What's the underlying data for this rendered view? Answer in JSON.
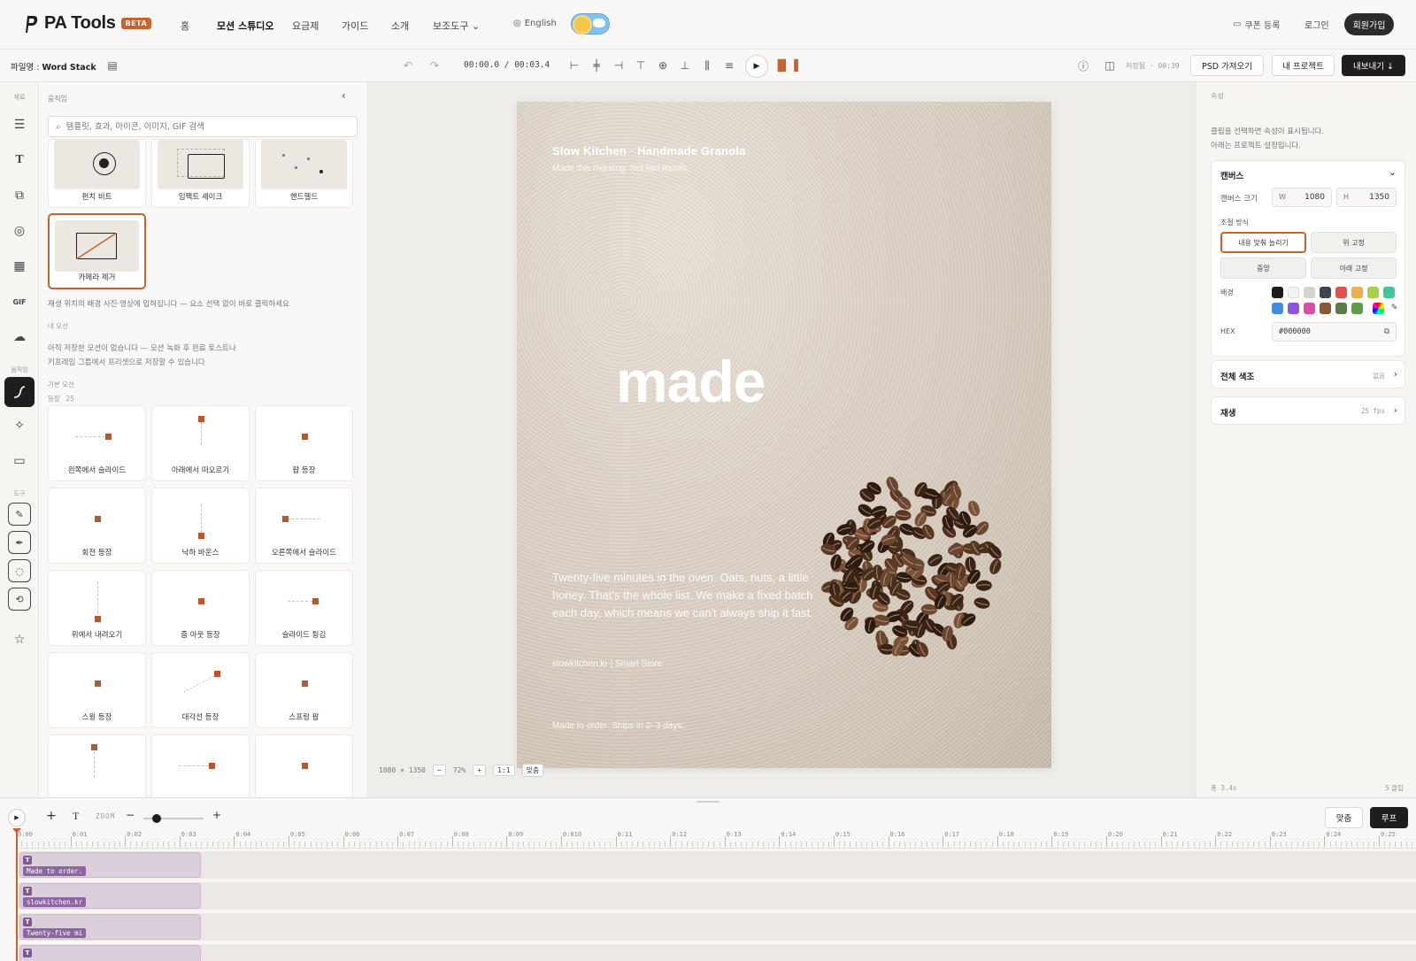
{
  "nav": {
    "brand": "PA Tools",
    "beta": "BETA",
    "links": [
      "홈",
      "모션 스튜디오",
      "요금제",
      "가이드",
      "소개",
      "보조도구"
    ],
    "active_link": "모션 스튜디오",
    "language": "English",
    "coupon": "쿠폰 등록",
    "login": "로그인",
    "signup": "회원가입"
  },
  "toolbar": {
    "filename_label": "파일명 : ",
    "filename": "Word Stack",
    "time": "00:00.0 / 00:03.4",
    "save_status": "저장됨 · 00:39",
    "psd_import": "PSD 가져오기",
    "my_projects": "내 프로젝트",
    "export": "내보내기 ↓"
  },
  "rail": {
    "section_materials": "재료",
    "section_motion": "움직임",
    "section_tools": "도구",
    "gif": "GIF"
  },
  "left_panel": {
    "title": "움직임",
    "search_placeholder": "템플릿, 효과, 아이콘, 이미지, GIF 검색",
    "top_cards": [
      "펀치 비트",
      "임팩트 셰이크",
      "핸드헬드"
    ],
    "selected_card": "카메라 제거",
    "hint": "재생 위치의 배경 사진·영상에 입혀집니다 — 요소 선택 없이 바로 클릭하세요",
    "my_motion_heading": "내 모션",
    "my_motion_empty_1": "아직 저장한 모션이 없습니다 — 모션 녹화 후 완료 토스트나",
    "my_motion_empty_2": "키프레임 그룹에서 프리셋으로 저장할 수 있습니다",
    "basic_heading": "기본 모션",
    "entrance_heading": "등장",
    "entrance_count": "25",
    "motion_cards": [
      "왼쪽에서 슬라이드",
      "아래에서 떠오르기",
      "팝 등장",
      "회전 등장",
      "낙하 바운스",
      "오른쪽에서 슬라이드",
      "위에서 내려오기",
      "줌 아웃 등장",
      "슬라이드 튕김",
      "스윙 등장",
      "대각선 등장",
      "스프링 팝",
      "",
      "",
      ""
    ]
  },
  "artboard": {
    "title": "Slow Kitchen · Handmade Granola",
    "subtitle": "Made this morning. Not last month.",
    "big_word": "made",
    "body": "Twenty-five minutes in the oven. Oats, nuts, a little honey. That's the whole list. We make a fixed batch each day, which means we can't always ship it fast.",
    "link": "slowkitchen.kr  |  Smart Store",
    "footer": "Made to order. Ships in 2–3 days."
  },
  "canvas_info": {
    "size": "1080 × 1350",
    "minus": "−",
    "zoom": "72%",
    "plus": "+",
    "ratio": "1:1",
    "fit": "맞춤"
  },
  "right_panel": {
    "title": "속성",
    "hint_1": "클립을 선택하면 속성이 표시됩니다.",
    "hint_2": "아래는 프로젝트 설정입니다.",
    "canvas_title": "캔버스",
    "canvas_size_label": "캔버스 크기",
    "w_key": "W",
    "w_value": "1080",
    "h_key": "H",
    "h_value": "1350",
    "fit_mode_label": "조절 방식",
    "fit_modes": [
      "내용 맞춰 늘리기",
      "위 고정",
      "중앙",
      "아래 고정"
    ],
    "bg_label": "배경",
    "swatches": [
      "#1b1b1b",
      "#f3f3f3",
      "#d6d3cc",
      "#3f4450",
      "#e0524e",
      "#e8b04a",
      "#a8cf4e",
      "#44c49a",
      "#3f8ee0",
      "#8a55e0",
      "#d94fa8",
      "#8a5733",
      "#5b7a4a",
      "#5e9e4a"
    ],
    "hex_label": "HEX",
    "hex_value": "#000000",
    "grading_title": "전체 색조",
    "grading_value": "없음",
    "playback_title": "재생",
    "playback_value": "25 fps",
    "total": "총 3.4s",
    "clips": "5 클립"
  },
  "timeline": {
    "zoom_label": "ZOOM",
    "fit": "맞춤",
    "loop": "루프",
    "ticks": [
      "0:00",
      "0:01",
      "0:02",
      "0:03",
      "0:04",
      "0:05",
      "0:06",
      "0:07",
      "0:08",
      "0:09",
      "0:010",
      "0:11",
      "0:12",
      "0:13",
      "0:14",
      "0:15",
      "0:16",
      "0:17",
      "0:18",
      "0:19",
      "0:20",
      "0:21",
      "0:22",
      "0:23",
      "0:24",
      "0:25"
    ],
    "clips": [
      "Made to order.",
      "slowkitchen.kr",
      "Twenty-five mi",
      ""
    ],
    "zoom_level": 0.22
  },
  "colors": {
    "accent": "#c8622e",
    "dark": "#1e1e1e",
    "clip": "#8c66a0"
  }
}
